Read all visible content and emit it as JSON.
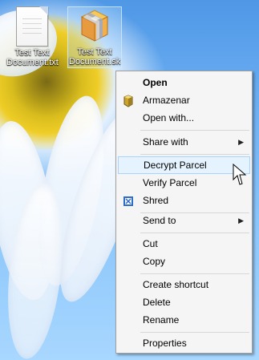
{
  "desktop": {
    "icons": [
      {
        "label": "Test Text\nDocument.txt",
        "icon": "text-document-icon"
      },
      {
        "label": "Test Text\nDocument.sk",
        "icon": "parcel-document-icon"
      }
    ]
  },
  "context_menu": {
    "items": [
      {
        "label": "Open",
        "bold": true
      },
      {
        "label": "Armazenar",
        "icon": "armazenar-icon"
      },
      {
        "label": "Open with..."
      },
      {
        "label": "Share with",
        "submenu": true
      },
      {
        "label": "Decrypt Parcel",
        "highlighted": true
      },
      {
        "label": "Verify Parcel"
      },
      {
        "label": "Shred",
        "icon": "shred-icon"
      },
      {
        "label": "Send to",
        "submenu": true
      },
      {
        "label": "Cut"
      },
      {
        "label": "Copy"
      },
      {
        "label": "Create shortcut"
      },
      {
        "label": "Delete"
      },
      {
        "label": "Rename"
      },
      {
        "label": "Properties"
      }
    ],
    "submenu_arrow": "▶"
  },
  "colors": {
    "menu_background": "#f5f5f5",
    "menu_border": "#a0a0a0",
    "menu_highlight": "#e5f3ff",
    "menu_highlight_border": "#a8d3ff",
    "desktop_sky": "#71b2f4"
  }
}
